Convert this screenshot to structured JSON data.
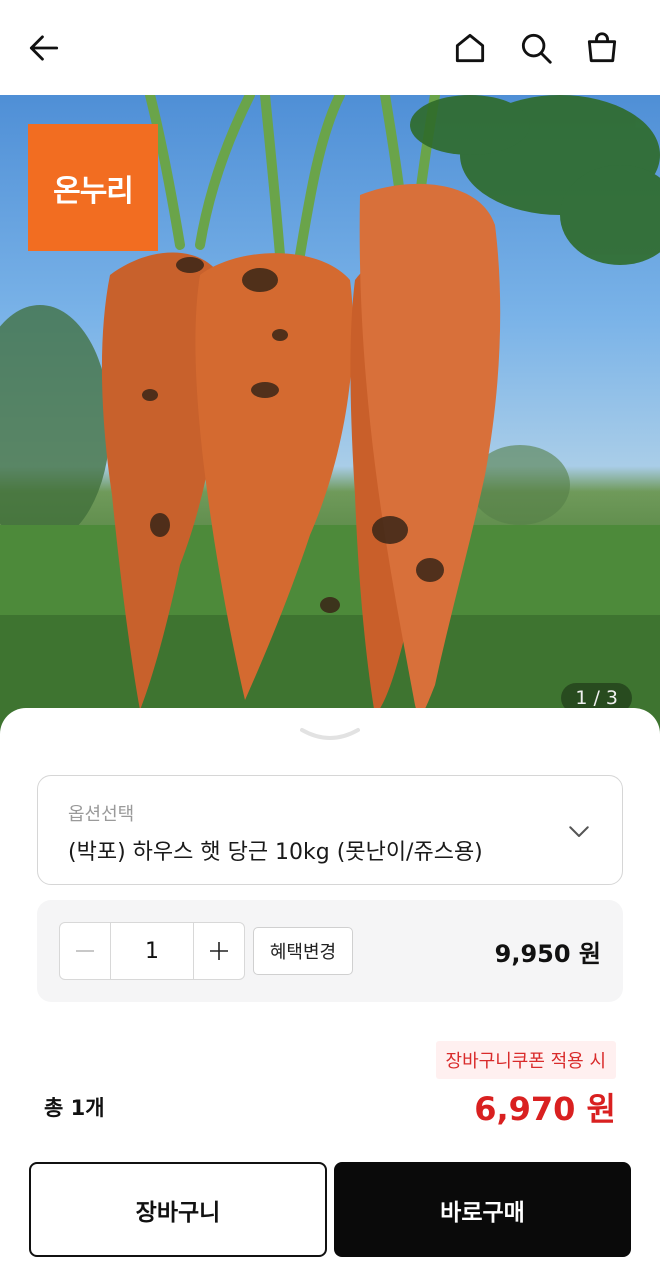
{
  "header": {
    "icons": [
      "back-arrow-icon",
      "home-icon",
      "search-icon",
      "shopping-bag-icon"
    ]
  },
  "product_image": {
    "brand_logo": "온누리",
    "pager": "1 / 3"
  },
  "option_select": {
    "label": "옵션선택",
    "value": "(박포) 하우스 햇 당근 10kg (못난이/쥬스용)"
  },
  "quantity": {
    "value": "1",
    "benefit_button": "혜택변경",
    "price": "9,950 원"
  },
  "total": {
    "coupon_tag": "장바구니쿠폰 적용 시",
    "count": "총 1개",
    "price": "6,970 원"
  },
  "actions": {
    "cart": "장바구니",
    "buy": "바로구매"
  },
  "colors": {
    "accent_red": "#d92020",
    "logo_orange": "#f26d21",
    "buy_button": "#0a0a0a"
  }
}
